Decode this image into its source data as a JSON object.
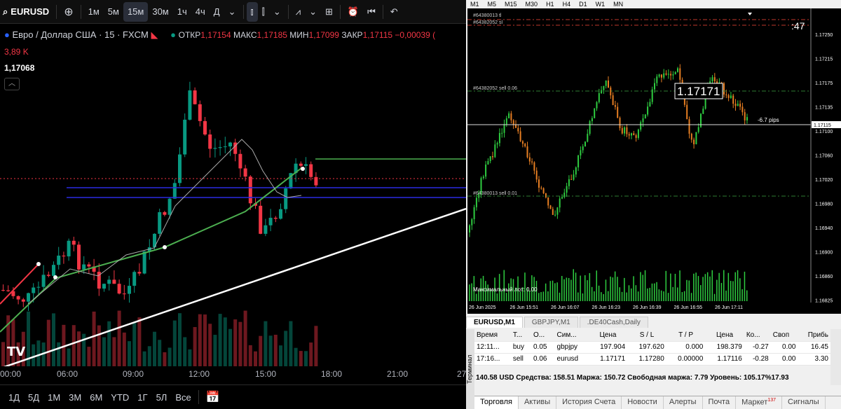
{
  "tv": {
    "toolbar": {
      "symbol": "EURUSD",
      "intervals": [
        "1м",
        "5м",
        "15м",
        "30м",
        "1ч",
        "4ч",
        "Д"
      ],
      "selected_interval": "15м"
    },
    "legend": {
      "title": "Евро / Доллар США · 15 · FXCM",
      "open_label": "ОТКР",
      "open": "1,17154",
      "high_label": "МАКС",
      "high": "1,17185",
      "low_label": "МИН",
      "low": "1,17099",
      "close_label": "ЗАКР",
      "close": "1,17115",
      "change": "−0,00039 (",
      "volume": "3,89 K",
      "price": "1,17068"
    },
    "xaxis": [
      "00:00",
      "06:00",
      "09:00",
      "12:00",
      "15:00",
      "18:00",
      "21:00",
      "27"
    ],
    "ranges": [
      "1Д",
      "5Д",
      "1М",
      "3М",
      "6М",
      "YTD",
      "1Г",
      "5Л",
      "Все"
    ],
    "colors": {
      "up": "#089981",
      "down": "#f23645"
    }
  },
  "mt": {
    "timeframes": [
      "M1",
      "M5",
      "M15",
      "M30",
      "H1",
      "H4",
      "D1",
      "W1",
      "MN"
    ],
    "chart": {
      "timer": ":47",
      "top_labels": [
        "#64380013 tl",
        "#64382052 sl"
      ],
      "sell_label_1": "#64382052 sell 0.06",
      "sell_label_2": "#64380013 sell 0.01",
      "big_price": "1.17171",
      "pips": "-6.7 pips",
      "maxlot": "Максимальный лот: 0.00",
      "price_axis": [
        "1.17250",
        "1.17215",
        "1.17175",
        "1.17135",
        "1.17100",
        "1.17060",
        "1.17020",
        "1.16980",
        "1.16940",
        "1.16900",
        "1.16860",
        "1.16825"
      ],
      "current_price": "1.17115",
      "time_axis": [
        "26 Jun 2025",
        "26 Jun 15:51",
        "26 Jun 16:07",
        "26 Jun 16:23",
        "26 Jun 16:39",
        "26 Jun 16:55",
        "26 Jun 17:11"
      ]
    },
    "tabs": [
      "EURUSD,M1",
      "GBPJPY,M1",
      ".DE40Cash,Daily"
    ],
    "table": {
      "headers": [
        "Время",
        "Т...",
        "О...",
        "Сим...",
        "Цена",
        "S / L",
        "T / P",
        "Цена",
        "Ко...",
        "Своп",
        "Прибь"
      ],
      "rows": [
        [
          "12:11...",
          "buy",
          "0.05",
          "gbpjpy",
          "197.904",
          "197.620",
          "0.000",
          "198.379",
          "-0.27",
          "0.00",
          "16.45"
        ],
        [
          "17:16...",
          "sell",
          "0.06",
          "eurusd",
          "1.17171",
          "1.17280",
          "0.00000",
          "1.17116",
          "-0.28",
          "0.00",
          "3.30"
        ]
      ]
    },
    "summary": "140.58 USD  Средства: 158.51  Маржа: 150.72  Свободная маржа: 7.79  Уровень: 105.17%17.93",
    "terminal_label": "Терминал",
    "bottom_tabs": [
      "Торговля",
      "Активы",
      "История Счета",
      "Новости",
      "Алерты",
      "Почта",
      "Маркет",
      "Сигналы"
    ],
    "market_badge": "137"
  }
}
